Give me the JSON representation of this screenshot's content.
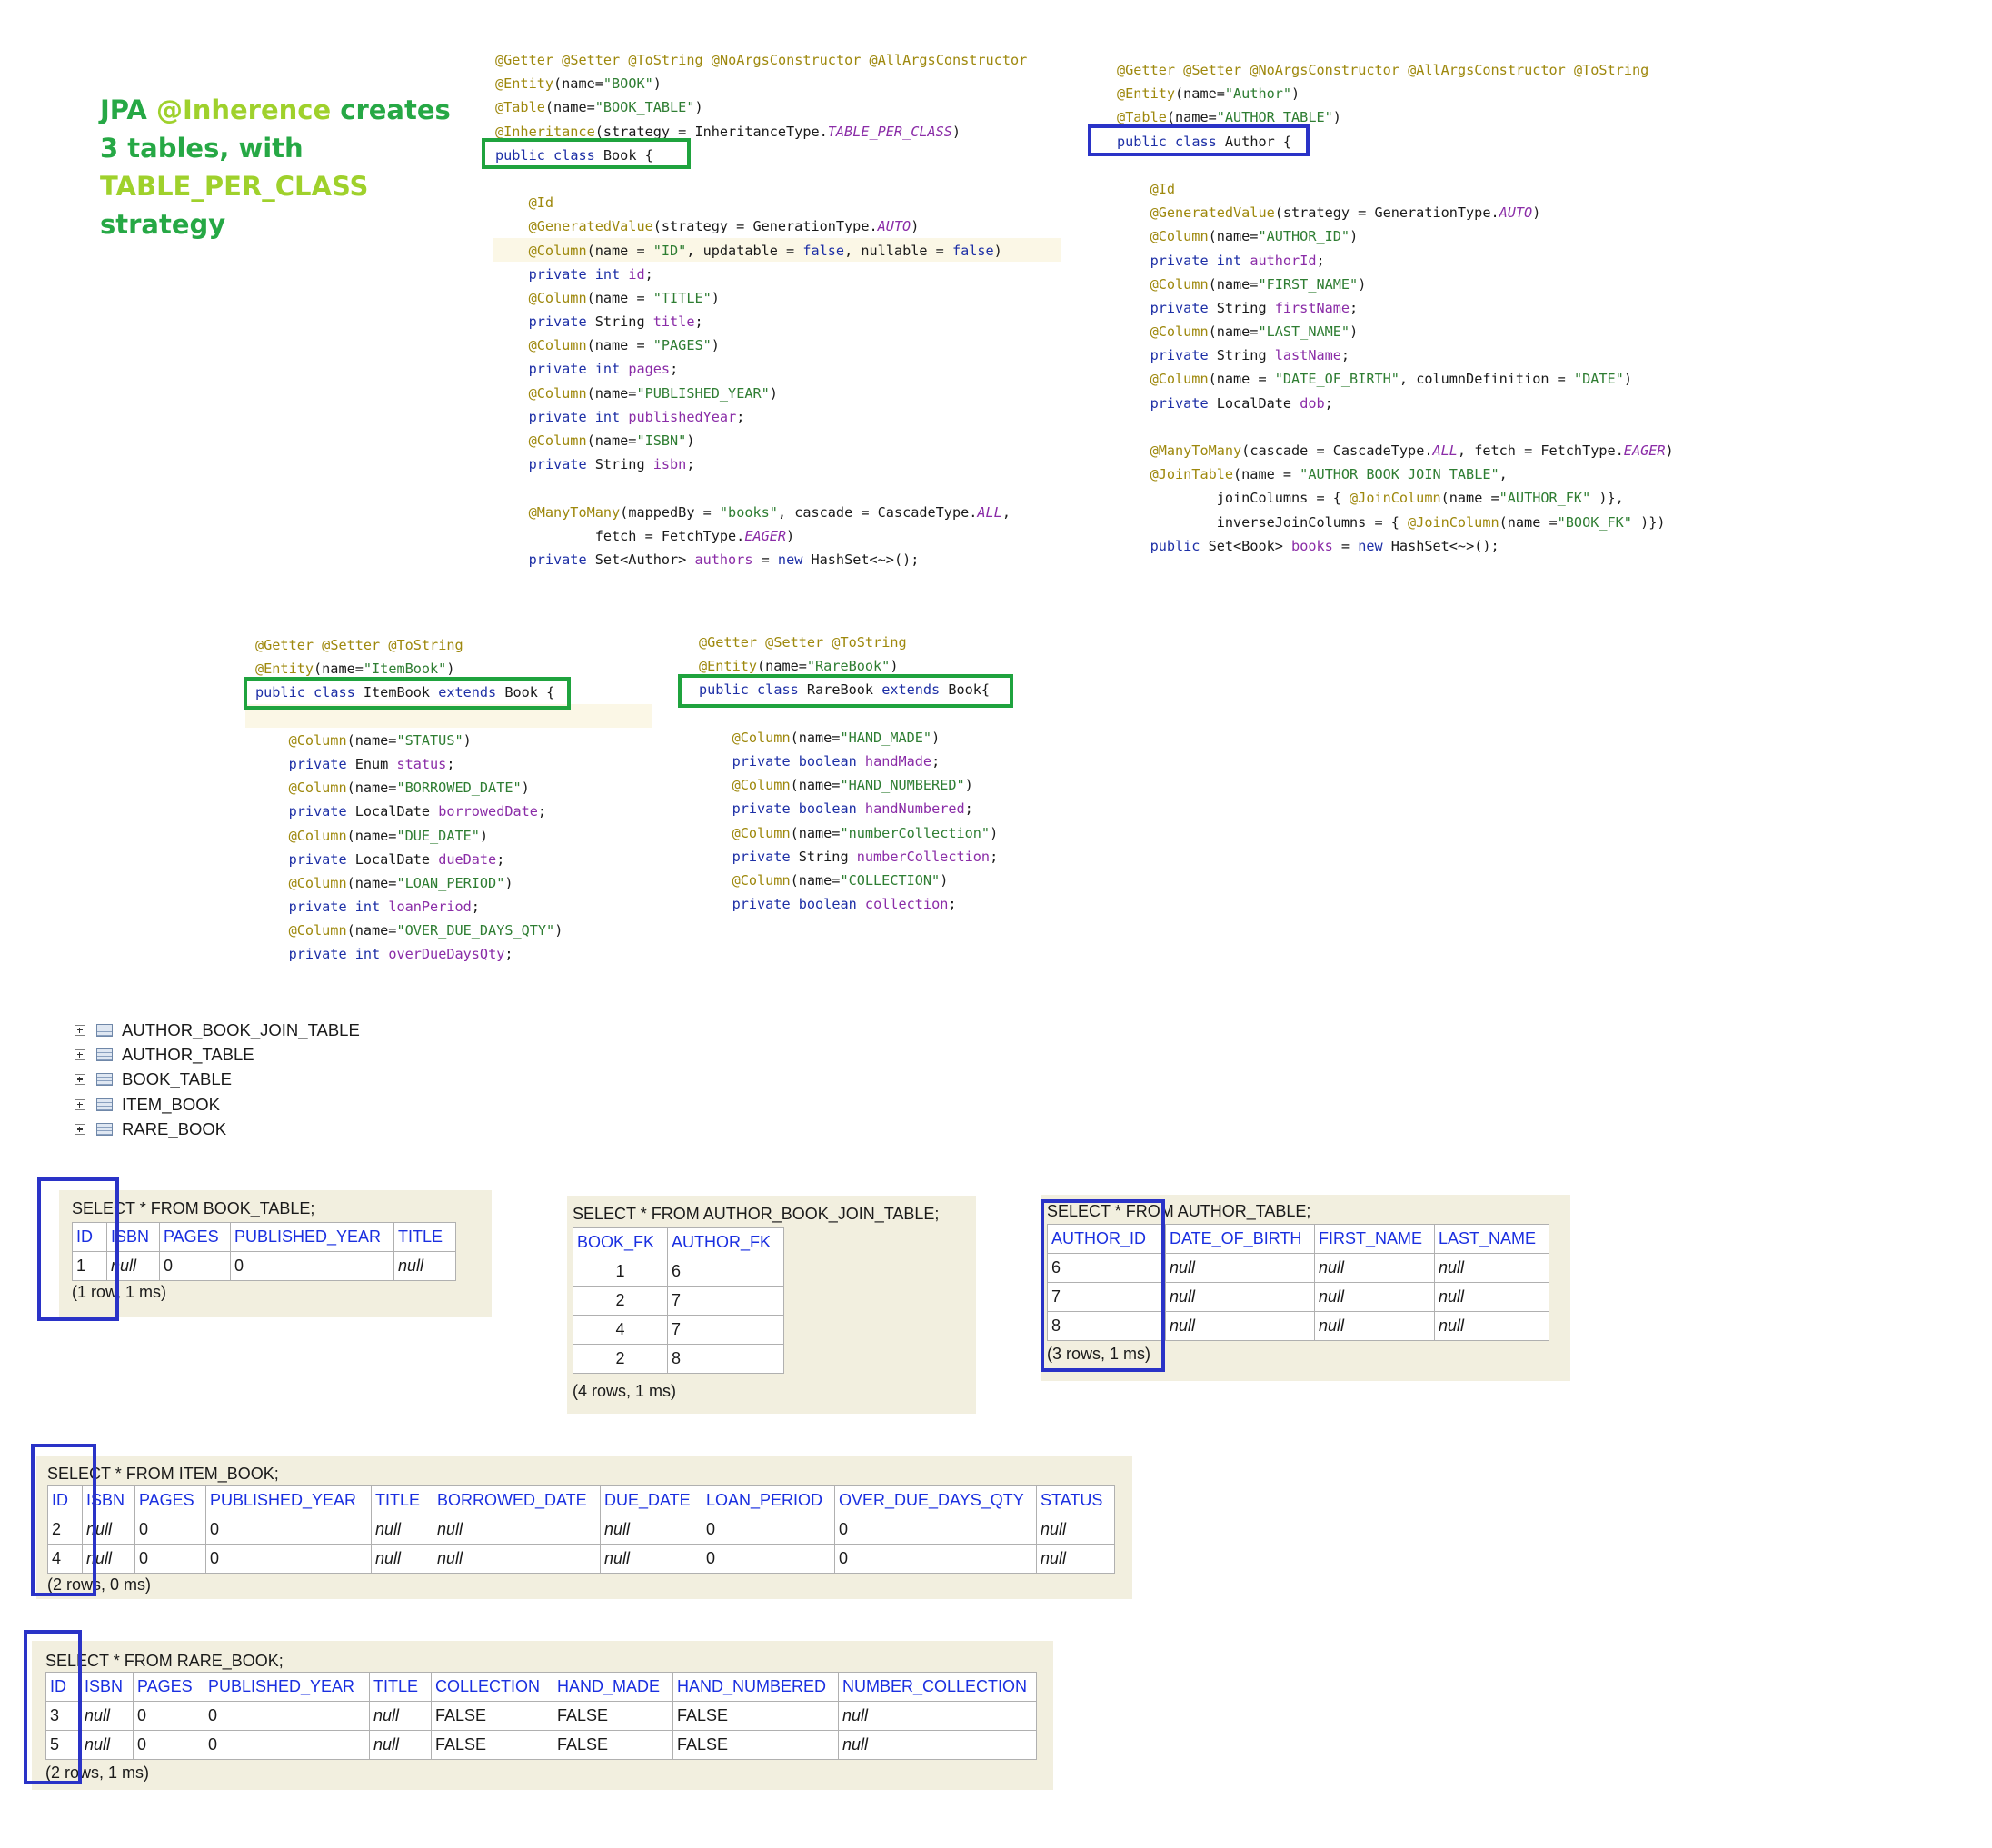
{
  "title": {
    "line1_a": "JPA ",
    "line1_b": "@Inherence",
    "line1_c": " creates",
    "line2": "3 tables, with",
    "line3": "TABLE_PER_CLASS",
    "line4": "strategy"
  },
  "book_code": [
    "@Getter @Setter @ToString @NoArgsConstructor @AllArgsConstructor",
    "@Entity(name=\"BOOK\")",
    "@Table(name=\"BOOK_TABLE\")",
    "@Inheritance(strategy = InheritanceType.TABLE_PER_CLASS)",
    "public class Book {",
    "",
    "    @Id",
    "    @GeneratedValue(strategy = GenerationType.AUTO)",
    "    @Column(name = \"ID\", updatable = false, nullable = false)",
    "    private int id;",
    "    @Column(name = \"TITLE\")",
    "    private String title;",
    "    @Column(name = \"PAGES\")",
    "    private int pages;",
    "    @Column(name=\"PUBLISHED_YEAR\")",
    "    private int publishedYear;",
    "    @Column(name=\"ISBN\")",
    "    private String isbn;",
    "",
    "    @ManyToMany(mappedBy = \"books\", cascade = CascadeType.ALL,",
    "            fetch = FetchType.EAGER)",
    "    private Set<Author> authors = new HashSet<~>();"
  ],
  "author_code": [
    "@Getter @Setter @NoArgsConstructor @AllArgsConstructor @ToString",
    "@Entity(name=\"Author\")",
    "@Table(name=\"AUTHOR_TABLE\")",
    "public class Author {",
    "",
    "    @Id",
    "    @GeneratedValue(strategy = GenerationType.AUTO)",
    "    @Column(name=\"AUTHOR_ID\")",
    "    private int authorId;",
    "    @Column(name=\"FIRST_NAME\")",
    "    private String firstName;",
    "    @Column(name=\"LAST_NAME\")",
    "    private String lastName;",
    "    @Column(name = \"DATE_OF_BIRTH\", columnDefinition = \"DATE\")",
    "    private LocalDate dob;",
    "",
    "    @ManyToMany(cascade = CascadeType.ALL, fetch = FetchType.EAGER)",
    "    @JoinTable(name = \"AUTHOR_BOOK_JOIN_TABLE\",",
    "            joinColumns = { @JoinColumn(name =\"AUTHOR_FK\" )},",
    "            inverseJoinColumns = { @JoinColumn(name =\"BOOK_FK\" )})",
    "    public Set<Book> books = new HashSet<~>();"
  ],
  "itembook_code": [
    "@Getter @Setter @ToString",
    "@Entity(name=\"ItemBook\")",
    "public class ItemBook extends Book {",
    "",
    "    @Column(name=\"STATUS\")",
    "    private Enum status;",
    "    @Column(name=\"BORROWED_DATE\")",
    "    private LocalDate borrowedDate;",
    "    @Column(name=\"DUE_DATE\")",
    "    private LocalDate dueDate;",
    "    @Column(name=\"LOAN_PERIOD\")",
    "    private int loanPeriod;",
    "    @Column(name=\"OVER_DUE_DAYS_QTY\")",
    "    private int overDueDaysQty;"
  ],
  "rarebook_code": [
    "@Getter @Setter @ToString",
    "@Entity(name=\"RareBook\")",
    "public class RareBook extends Book{",
    "",
    "    @Column(name=\"HAND_MADE\")",
    "    private boolean handMade;",
    "    @Column(name=\"HAND_NUMBERED\")",
    "    private boolean handNumbered;",
    "    @Column(name=\"numberCollection\")",
    "    private String numberCollection;",
    "    @Column(name=\"COLLECTION\")",
    "    private boolean collection;"
  ],
  "db_tree": [
    "AUTHOR_BOOK_JOIN_TABLE",
    "AUTHOR_TABLE",
    "BOOK_TABLE",
    "ITEM_BOOK",
    "RARE_BOOK"
  ],
  "results": {
    "book": {
      "query": "SELECT * FROM BOOK_TABLE;",
      "headers": [
        "ID",
        "ISBN",
        "PAGES",
        "PUBLISHED_YEAR",
        "TITLE"
      ],
      "rows": [
        [
          "1",
          "null",
          "0",
          "0",
          "null"
        ]
      ],
      "footer": "(1 row, 1 ms)"
    },
    "join": {
      "query": "SELECT * FROM AUTHOR_BOOK_JOIN_TABLE;",
      "headers": [
        "BOOK_FK",
        "AUTHOR_FK"
      ],
      "rows": [
        [
          "1",
          "6"
        ],
        [
          "2",
          "7"
        ],
        [
          "4",
          "7"
        ],
        [
          "2",
          "8"
        ]
      ],
      "footer": "(4 rows, 1 ms)"
    },
    "author": {
      "query": "SELECT * FROM AUTHOR_TABLE;",
      "headers": [
        "AUTHOR_ID",
        "DATE_OF_BIRTH",
        "FIRST_NAME",
        "LAST_NAME"
      ],
      "rows": [
        [
          "6",
          "null",
          "null",
          "null"
        ],
        [
          "7",
          "null",
          "null",
          "null"
        ],
        [
          "8",
          "null",
          "null",
          "null"
        ]
      ],
      "footer": "(3 rows, 1 ms)"
    },
    "item": {
      "query": "SELECT * FROM ITEM_BOOK;",
      "headers": [
        "ID",
        "ISBN",
        "PAGES",
        "PUBLISHED_YEAR",
        "TITLE",
        "BORROWED_DATE",
        "DUE_DATE",
        "LOAN_PERIOD",
        "OVER_DUE_DAYS_QTY",
        "STATUS"
      ],
      "rows": [
        [
          "2",
          "null",
          "0",
          "0",
          "null",
          "null",
          "null",
          "0",
          "0",
          "null"
        ],
        [
          "4",
          "null",
          "0",
          "0",
          "null",
          "null",
          "null",
          "0",
          "0",
          "null"
        ]
      ],
      "footer": "(2 rows, 0 ms)"
    },
    "rare": {
      "query": "SELECT * FROM RARE_BOOK;",
      "headers": [
        "ID",
        "ISBN",
        "PAGES",
        "PUBLISHED_YEAR",
        "TITLE",
        "COLLECTION",
        "HAND_MADE",
        "HAND_NUMBERED",
        "NUMBER_COLLECTION"
      ],
      "rows": [
        [
          "3",
          "null",
          "0",
          "0",
          "null",
          "FALSE",
          "FALSE",
          "FALSE",
          "null"
        ],
        [
          "5",
          "null",
          "0",
          "0",
          "null",
          "FALSE",
          "FALSE",
          "FALSE",
          "null"
        ]
      ],
      "footer": "(2 rows, 1 ms)"
    }
  }
}
